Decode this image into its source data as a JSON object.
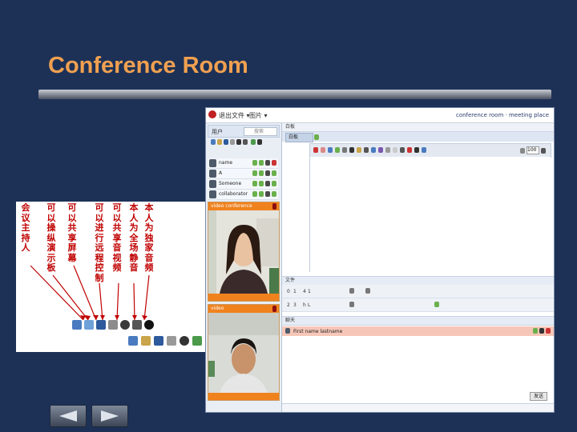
{
  "slide": {
    "title": "Conference Room"
  },
  "annotations": [
    "会议主持人",
    "可以操纵演示板",
    "可以共享屏幕",
    "可以进行远程控制",
    "可以共享音视频",
    "本人为全场静音",
    "本人为独家音频"
  ],
  "app": {
    "menus": [
      "退出",
      "文件 ▾",
      "图片 ▾"
    ],
    "session_title": "conference room · meeting place",
    "users_label": "用户",
    "search_placeholder": "搜索",
    "users": [
      "name",
      "A",
      "Someone",
      "collaborator"
    ],
    "video_panels": [
      {
        "label": "video conference"
      },
      {
        "label": "video"
      }
    ],
    "whiteboard": {
      "header": "白板",
      "tab": "白板",
      "zoom": "100"
    },
    "sections": {
      "files": "文件",
      "chat": "聊天"
    },
    "grid_rows": [
      [
        "0",
        "1",
        "4",
        "1"
      ],
      [
        "2",
        "3",
        "h",
        "L"
      ]
    ],
    "chat_user": "First name lastname",
    "chat_input_hint": "你好",
    "send_label": "发送"
  },
  "nav": {
    "prev": "previous",
    "next": "next"
  }
}
